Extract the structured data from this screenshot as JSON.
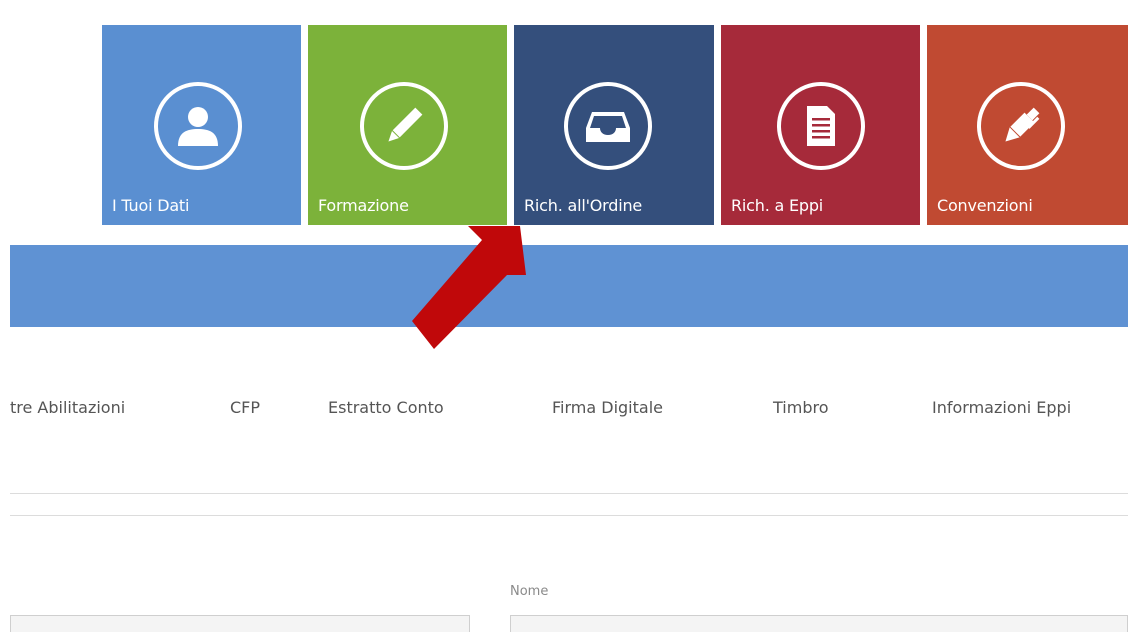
{
  "tiles": [
    {
      "label": "I Tuoi Dati",
      "icon": "user-icon",
      "color": "#5a8fd1"
    },
    {
      "label": "Formazione",
      "icon": "pencil-icon",
      "color": "#7cb23a"
    },
    {
      "label": "Rich. all'Ordine",
      "icon": "inbox-icon",
      "color": "#344f7c"
    },
    {
      "label": "Rich. a Eppi",
      "icon": "document-icon",
      "color": "#a62a3a"
    },
    {
      "label": "Convenzioni",
      "icon": "pen-icon",
      "color": "#c04a32"
    }
  ],
  "header_bar": {
    "color": "#5f92d3"
  },
  "nav": {
    "items": [
      {
        "label": "tre Abilitazioni"
      },
      {
        "label": "CFP"
      },
      {
        "label": "Estratto Conto"
      },
      {
        "label": "Firma Digitale"
      },
      {
        "label": "Timbro"
      },
      {
        "label": "Informazioni Eppi"
      }
    ]
  },
  "form": {
    "name_label": "Nome"
  },
  "annotation": {
    "arrow_color": "#c0080a",
    "arrow_icon": "arrow-pointer-icon"
  }
}
